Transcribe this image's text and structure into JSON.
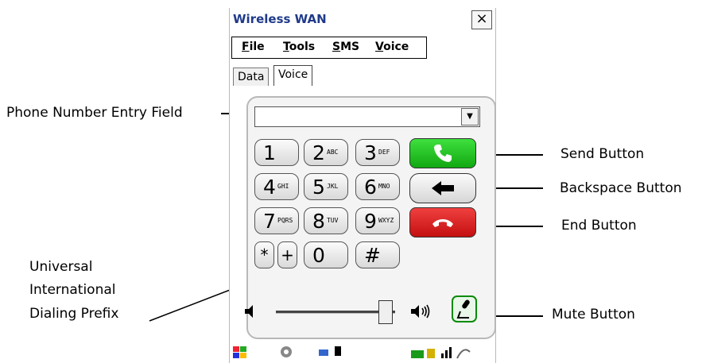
{
  "window": {
    "title": "Wireless WAN",
    "close_glyph": "×"
  },
  "menu": {
    "items": [
      "File",
      "Tools",
      "SMS",
      "Voice"
    ],
    "underline_letters": [
      "F",
      "T",
      "S",
      "V"
    ]
  },
  "tabs": [
    {
      "label": "Data",
      "active": false
    },
    {
      "label": "Voice",
      "active": true
    }
  ],
  "phone_field": {
    "value": ""
  },
  "keypad": [
    {
      "digit": "1",
      "letters": ""
    },
    {
      "digit": "2",
      "letters": "ABC"
    },
    {
      "digit": "3",
      "letters": "DEF"
    },
    {
      "digit": "4",
      "letters": "GHI"
    },
    {
      "digit": "5",
      "letters": "JKL"
    },
    {
      "digit": "6",
      "letters": "MNO"
    },
    {
      "digit": "7",
      "letters": "PQRS"
    },
    {
      "digit": "8",
      "letters": "TUV"
    },
    {
      "digit": "9",
      "letters": "WXYZ"
    }
  ],
  "bottom_keys": {
    "star": "*",
    "plus": "+",
    "zero": "0",
    "hash": "#"
  },
  "volume": {
    "level": 0.86
  },
  "callouts": {
    "phone_field": "Phone Number Entry Field",
    "send": "Send Button",
    "backspace": "Backspace Button",
    "end": "End Button",
    "prefix_line1": "Universal",
    "prefix_line2": "International",
    "prefix_line3": "Dialing Prefix",
    "mute": "Mute Button"
  },
  "colors": {
    "title_text": "#1f3a8a",
    "send_green": "#1ec81e",
    "end_red": "#dd1a1a",
    "mute_green": "#0a8a0a"
  },
  "icons": [
    "close-icon",
    "dropdown-arrow-icon",
    "phone-handset-icon",
    "left-arrow-icon",
    "hang-up-icon",
    "speaker-low-icon",
    "speaker-high-icon",
    "microphone-icon",
    "windows-start-icon",
    "taskbar-status-icons"
  ]
}
